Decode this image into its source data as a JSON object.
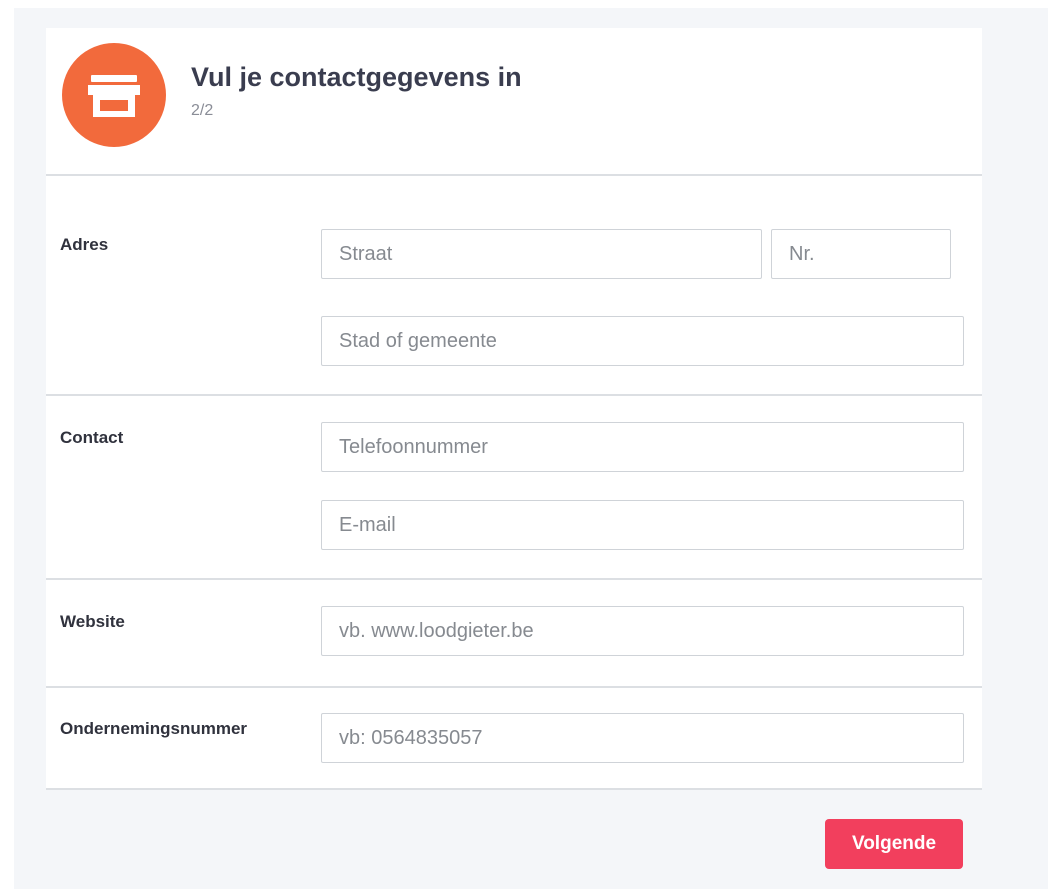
{
  "header": {
    "icon": "store-icon",
    "avatar_color": "#f26a3c",
    "title": "Vul je contactgegevens in",
    "step": "2/2"
  },
  "sections": {
    "address": {
      "label": "Adres",
      "street_placeholder": "Straat",
      "number_placeholder": "Nr.",
      "city_placeholder": "Stad of gemeente"
    },
    "contact": {
      "label": "Contact",
      "phone_placeholder": "Telefoonnummer",
      "email_placeholder": "E-mail"
    },
    "website": {
      "label": "Website",
      "placeholder": "vb. www.loodgieter.be"
    },
    "company_number": {
      "label": "Ondernemingsnummer",
      "placeholder": "vb: 0564835057"
    }
  },
  "actions": {
    "next_label": "Volgende",
    "next_color": "#f23f5d"
  }
}
